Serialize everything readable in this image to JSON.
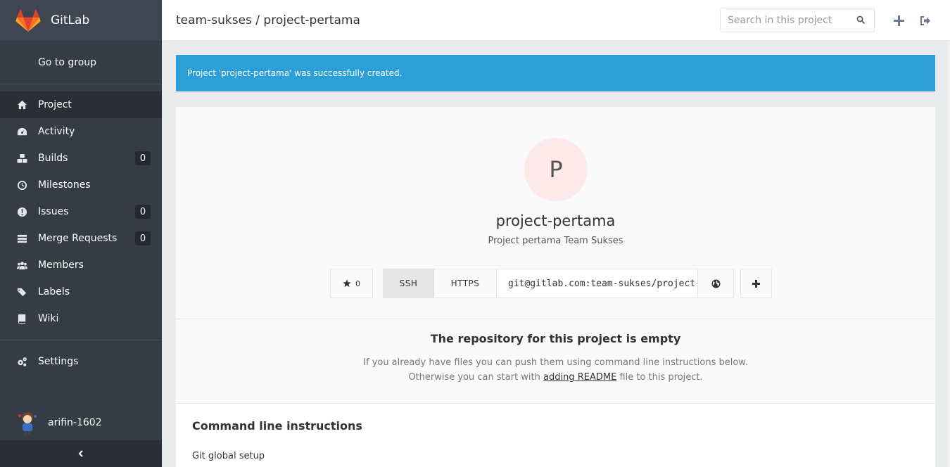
{
  "app": {
    "name": "GitLab"
  },
  "sidebar": {
    "go_to_group": "Go to group",
    "items": [
      {
        "label": "Project",
        "icon": "home-icon",
        "active": true
      },
      {
        "label": "Activity",
        "icon": "dashboard-icon"
      },
      {
        "label": "Builds",
        "icon": "cubes-icon",
        "badge": "0"
      },
      {
        "label": "Milestones",
        "icon": "clock-icon"
      },
      {
        "label": "Issues",
        "icon": "exclamation-circle-icon",
        "badge": "0"
      },
      {
        "label": "Merge Requests",
        "icon": "merge-list-icon",
        "badge": "0"
      },
      {
        "label": "Members",
        "icon": "users-icon"
      },
      {
        "label": "Labels",
        "icon": "tags-icon"
      },
      {
        "label": "Wiki",
        "icon": "book-icon"
      }
    ],
    "settings": {
      "label": "Settings",
      "icon": "cogs-icon"
    },
    "user": {
      "name": "arifin-1602"
    },
    "collapse_icon": "chevron-left-icon"
  },
  "header": {
    "breadcrumb": "team-sukses / project-pertama",
    "search_placeholder": "Search in this project"
  },
  "flash": {
    "message": "Project 'project-pertama' was successfully created."
  },
  "project": {
    "avatar_letter": "P",
    "name": "project-pertama",
    "description": "Project pertama Team Sukses",
    "star_count": "0",
    "clone": {
      "ssh_label": "SSH",
      "https_label": "HTTPS",
      "url": "git@gitlab.com:team-sukses/project-pertama.git",
      "selected": "SSH"
    }
  },
  "empty_repo": {
    "title": "The repository for this project is empty",
    "line1": "If you already have files you can push them using command line instructions below.",
    "line2_prefix": "Otherwise you can start with ",
    "line2_link": "adding README",
    "line2_suffix": " file to this project."
  },
  "command_line": {
    "title": "Command line instructions",
    "git_global_setup": "Git global setup"
  },
  "colors": {
    "sidebar_bg": "#363c45",
    "flash_bg": "#2d9fd8",
    "avatar_bg": "#fde9ea"
  }
}
